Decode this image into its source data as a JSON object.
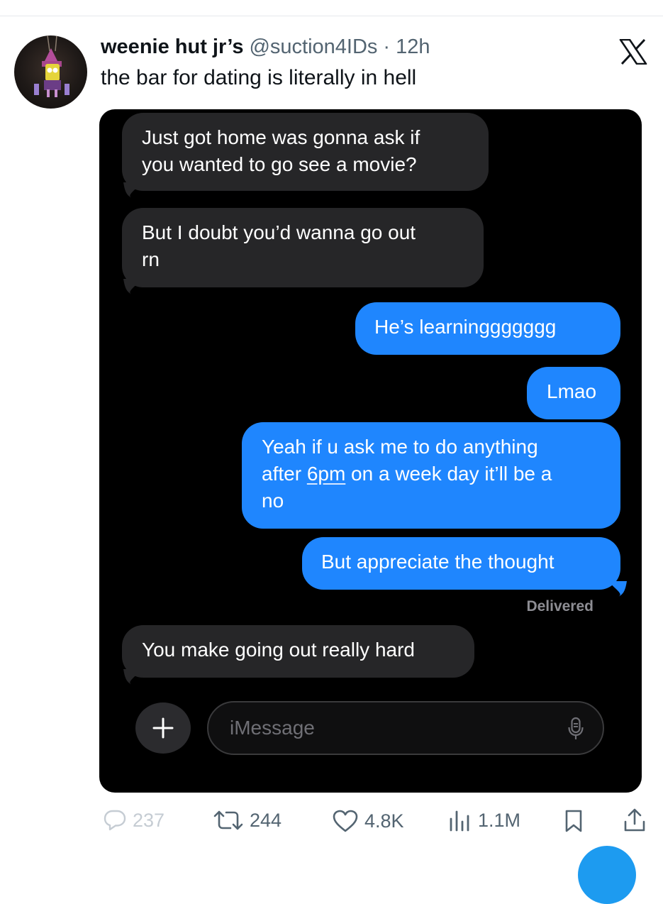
{
  "tweet": {
    "display_name": "weenie hut jr’s",
    "handle": "@suction4IDs",
    "separator": "·",
    "time": "12h",
    "text": "the bar for dating is literally in hell",
    "icons": {
      "avatar": "avatar-image",
      "platform": "x-logo-icon"
    }
  },
  "conversation": {
    "messages": [
      {
        "direction": "incoming",
        "lines": [
          "Just got home was gonna ask if",
          "you wanted to go see a movie?"
        ]
      },
      {
        "direction": "incoming",
        "lines": [
          "But I doubt you’d wanna go out",
          "rn"
        ]
      },
      {
        "direction": "outgoing",
        "lines": [
          "He’s learninggggggg"
        ]
      },
      {
        "direction": "outgoing",
        "lines": [
          "Lmao"
        ]
      },
      {
        "direction": "outgoing",
        "line1": "Yeah if u ask me to do anything",
        "line2_prefix": "after ",
        "line2_link": "6pm",
        "line2_suffix": " on a week day it’ll be a",
        "line3": "no"
      },
      {
        "direction": "outgoing",
        "lines": [
          "But appreciate the thought"
        ]
      },
      {
        "direction": "incoming",
        "lines": [
          "You make going out really hard"
        ]
      }
    ],
    "status": "Delivered",
    "composer": {
      "placeholder": "iMessage",
      "icons": {
        "add": "plus-icon",
        "audio": "microphone-icon"
      }
    },
    "colors": {
      "incoming_bubble": "#262628",
      "outgoing_bubble": "#1f86fe",
      "background": "#000000"
    }
  },
  "engagement": {
    "replies": "237",
    "reposts": "244",
    "likes": "4.8K",
    "views": "1.1M",
    "icons": [
      "reply-icon",
      "repost-icon",
      "like-icon",
      "views-icon",
      "bookmark-icon",
      "share-icon"
    ]
  },
  "colors": {
    "text_primary": "#0f1419",
    "text_secondary": "#536471",
    "accent": "#1d9bf0"
  }
}
